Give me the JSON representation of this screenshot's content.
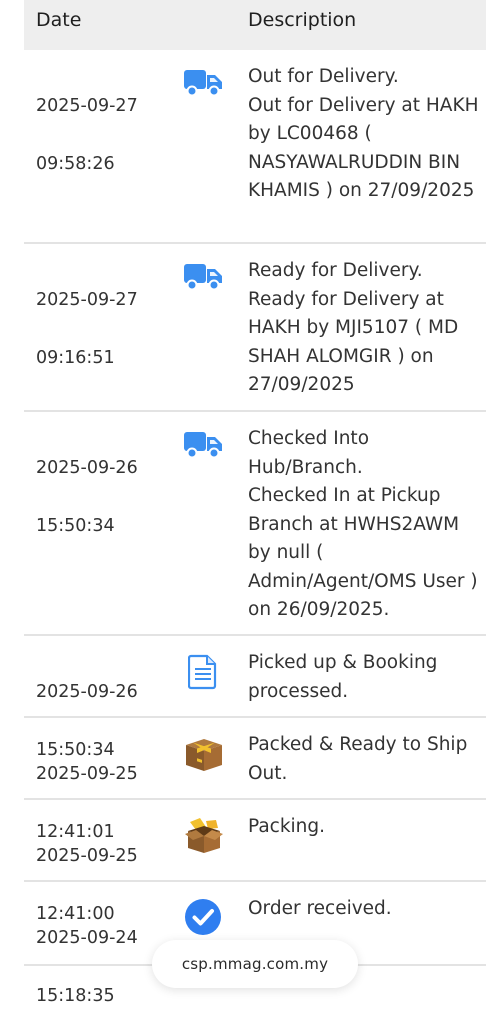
{
  "table": {
    "headers": {
      "date": "Date",
      "description": "Description"
    },
    "rows": [
      {
        "date": "2025-09-27",
        "time": "09:58:26",
        "icon": "truck-icon",
        "title": "Out for Delivery.",
        "detail": "Out for Delivery at HAKH by LC00468 ( NASYAWALRUDDIN BIN KHAMIS ) on 27/09/2025"
      },
      {
        "date": "2025-09-27",
        "time": "09:16:51",
        "icon": "truck-icon",
        "title": "Ready for Delivery.",
        "detail": "Ready for Delivery at HAKH by MJI5107 ( MD SHAH ALOMGIR ) on 27/09/2025"
      },
      {
        "date": "2025-09-26",
        "time": "15:50:34",
        "icon": "truck-icon",
        "title": "Checked Into Hub/Branch.",
        "detail": "Checked In at Pickup Branch at HWHS2AWM by null ( Admin/Agent/OMS User ) on 26/09/2025."
      },
      {
        "date": "2025-09-26",
        "time": "15:50:34",
        "icon": "document-icon",
        "title": "Picked up & Booking processed.",
        "detail": ""
      },
      {
        "date": "2025-09-25",
        "time": "12:41:01",
        "icon": "closed-box-icon",
        "title": "Packed & Ready to Ship Out.",
        "detail": ""
      },
      {
        "date": "2025-09-25",
        "time": "12:41:00",
        "icon": "open-box-icon",
        "title": "Packing.",
        "detail": ""
      },
      {
        "date": "2025-09-24",
        "time": "15:18:35",
        "icon": "check-circle-icon",
        "title": "Order received.",
        "detail": ""
      }
    ]
  },
  "browser": {
    "url": "csp.mmag.com.my"
  },
  "colors": {
    "header_bg": "#eeeeee",
    "truck_blue": "#3b8ff0",
    "check_blue": "#2f7ef0",
    "box_brown": "#8a5a2b",
    "tape_yellow": "#f2c12e"
  }
}
